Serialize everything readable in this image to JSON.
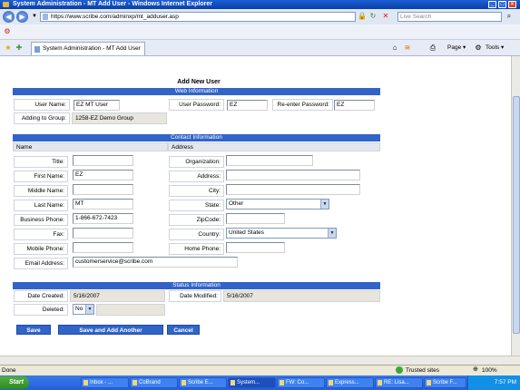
{
  "window": {
    "title": "System Administration - MT Add User - Windows Internet Explorer"
  },
  "browser": {
    "url": "https://www.scribe.com/adminxp/mt_adduser.asp",
    "search_placeholder": "Live Search",
    "tab_title": "System Administration - MT Add User",
    "commands": {
      "page": "Page",
      "tools": "Tools"
    }
  },
  "form": {
    "title": "Add New User",
    "web_section": {
      "header": "Web Information",
      "user_name_label": "User Name:",
      "user_name_value": "EZ MT User",
      "user_password_label": "User Password:",
      "user_password_value": "EZ",
      "reenter_password_label": "Re-enter Password:",
      "reenter_password_value": "EZ",
      "adding_group_label": "Adding to Group:",
      "adding_group_value": "1258-EZ Demo Group"
    },
    "contact_section": {
      "header": "Contact Information",
      "name_col": "Name",
      "address_col": "Address",
      "title_label": "Title:",
      "title_value": "",
      "first_name_label": "First Name:",
      "first_name_value": "EZ",
      "middle_name_label": "Middle Name:",
      "middle_name_value": "",
      "last_name_label": "Last Name:",
      "last_name_value": "MT",
      "business_phone_label": "Business Phone:",
      "business_phone_value": "1-866-672-7423",
      "fax_label": "Fax:",
      "fax_value": "",
      "mobile_phone_label": "Mobile Phone:",
      "mobile_phone_value": "",
      "email_label": "Email Address:",
      "email_value": "customerservice@scribe.com",
      "organization_label": "Organization:",
      "organization_value": "",
      "address_label": "Address:",
      "address_value": "",
      "city_label": "City:",
      "city_value": "",
      "state_label": "State:",
      "state_value": "Other",
      "zip_label": "ZipCode:",
      "zip_value": "",
      "country_label": "Country:",
      "country_value": "United States",
      "home_phone_label": "Home Phone:",
      "home_phone_value": ""
    },
    "status_section": {
      "header": "Status Information",
      "date_created_label": "Date Created:",
      "date_created_value": "5/16/2007",
      "date_modified_label": "Date Modified:",
      "date_modified_value": "5/16/2007",
      "deleted_label": "Deleted:",
      "deleted_value": "No"
    },
    "buttons": {
      "save": "Save",
      "save_add": "Save and Add Another",
      "cancel": "Cancel"
    }
  },
  "statusbar": {
    "text": "Done",
    "zone": "Trusted sites",
    "zoom": "100%"
  },
  "taskbar": {
    "start": "Start",
    "items": [
      "Inbox - ...",
      "CoBrand",
      "Scribe E...",
      "System...",
      "FW: Co...",
      "Express...",
      "RE: Lisa...",
      "Scribe F..."
    ],
    "clock": "7:57 PM"
  }
}
